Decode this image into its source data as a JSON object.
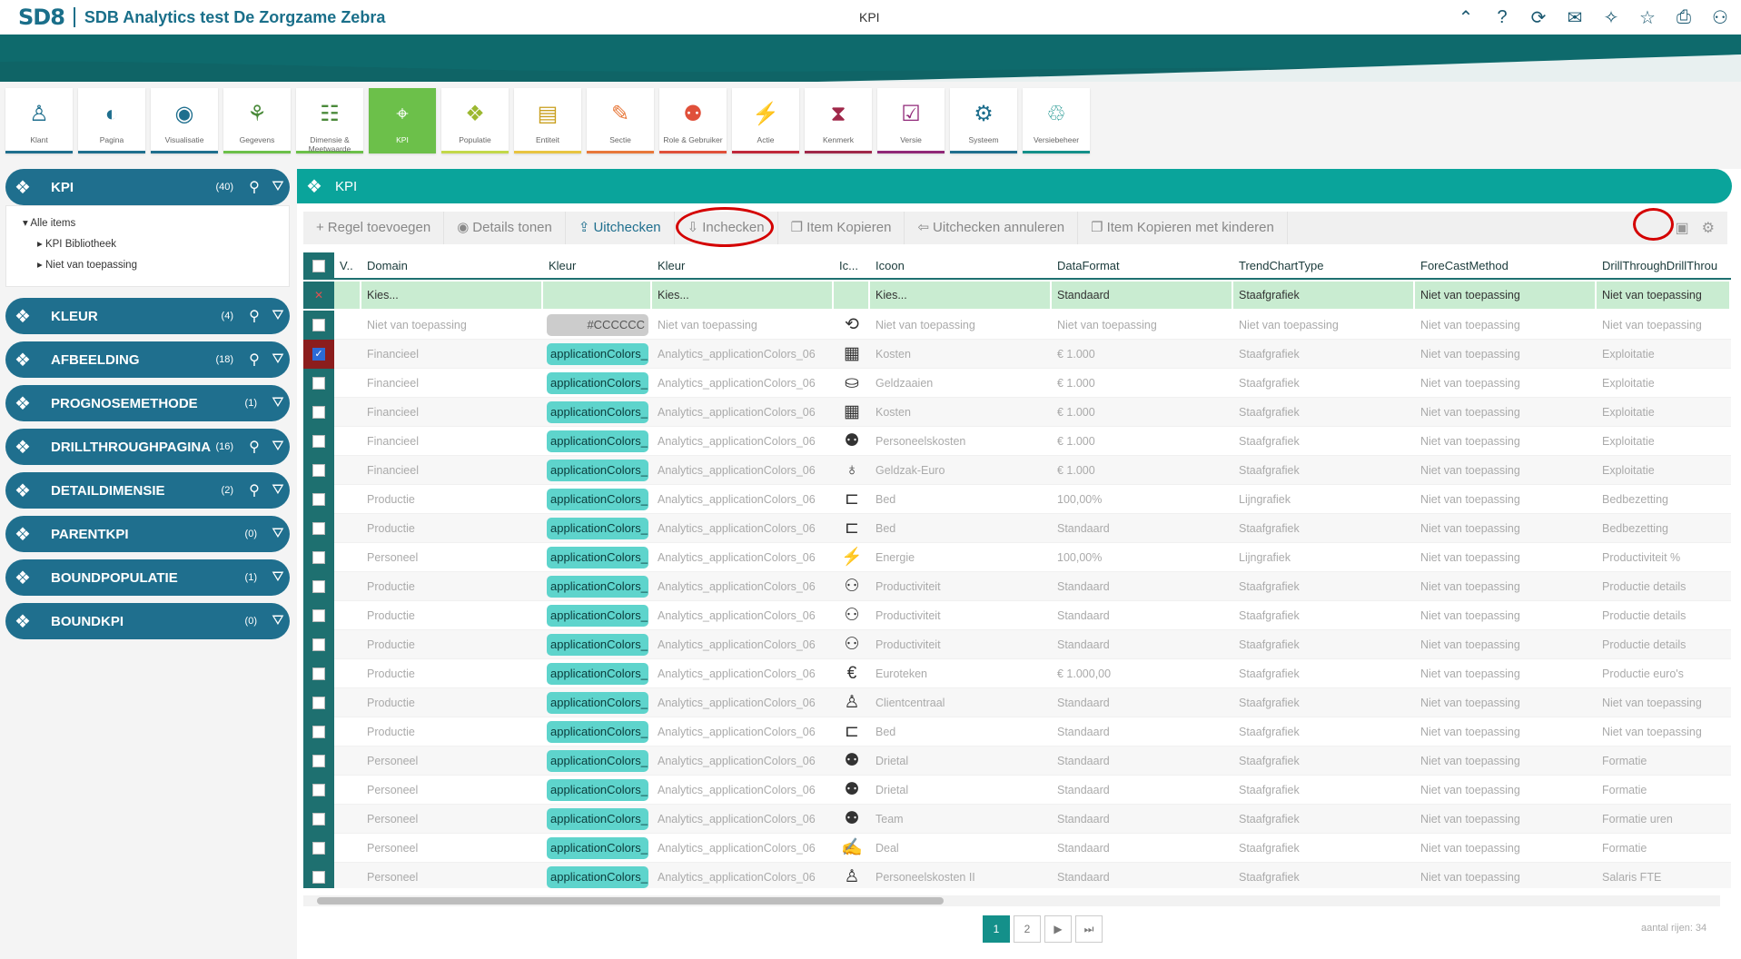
{
  "app": {
    "logo": "SD8",
    "title": "SDB Analytics test De Zorgzame Zebra",
    "page_title": "KPI"
  },
  "top_icons": [
    {
      "name": "collapse-up-icon",
      "glyph": "⌃"
    },
    {
      "name": "help-icon",
      "glyph": "?"
    },
    {
      "name": "refresh-icon",
      "glyph": "⟳"
    },
    {
      "name": "chat-icon",
      "glyph": "✉"
    },
    {
      "name": "star-plus-icon",
      "glyph": "✧"
    },
    {
      "name": "star-icon",
      "glyph": "☆"
    },
    {
      "name": "print-icon",
      "glyph": "⎙"
    },
    {
      "name": "user-icon",
      "glyph": "⚇"
    }
  ],
  "tiles": [
    {
      "label": "Klant",
      "glyph": "♙",
      "color": "#1f6f8e",
      "border": "#1f6f8e"
    },
    {
      "label": "Pagina",
      "glyph": "◐",
      "color": "#1f6f8e",
      "border": "#1f6f8e"
    },
    {
      "label": "Visualisatie",
      "glyph": "◉",
      "color": "#1f6f8e",
      "border": "#1f6f8e"
    },
    {
      "label": "Gegevens",
      "glyph": "⚘",
      "color": "#4a8a3a",
      "border": "#6cc04a"
    },
    {
      "label": "Dimensie & Meetwaarde",
      "glyph": "☷",
      "color": "#4a8a3a",
      "border": "#6cc04a"
    },
    {
      "label": "KPI",
      "glyph": "⌖",
      "color": "#ffffff",
      "border": "#6cc04a"
    },
    {
      "label": "Populatie",
      "glyph": "❖",
      "color": "#9cb830",
      "border": "#c3d84a"
    },
    {
      "label": "Entiteit",
      "glyph": "▤",
      "color": "#c9a020",
      "border": "#e8c440"
    },
    {
      "label": "Sectie",
      "glyph": "✎",
      "color": "#e8783a",
      "border": "#e8783a"
    },
    {
      "label": "Role & Gebruiker",
      "glyph": "⚉",
      "color": "#e0503a",
      "border": "#e0503a"
    },
    {
      "label": "Actie",
      "glyph": "⚡",
      "color": "#c0283a",
      "border": "#c0283a"
    },
    {
      "label": "Kenmerk",
      "glyph": "⧗",
      "color": "#a0284a",
      "border": "#a0284a"
    },
    {
      "label": "Versie",
      "glyph": "☑",
      "color": "#902878",
      "border": "#902878"
    },
    {
      "label": "Systeem",
      "glyph": "⚙",
      "color": "#1f6f8e",
      "border": "#1f6f8e"
    },
    {
      "label": "Versiebeheer",
      "glyph": "♲",
      "color": "#14908a",
      "border": "#14908a"
    }
  ],
  "left_panels": [
    {
      "name": "KPI",
      "count": "(40)",
      "search": true
    },
    {
      "name": "KLEUR",
      "count": "(4)",
      "search": true
    },
    {
      "name": "AFBEELDING",
      "count": "(18)",
      "search": true
    },
    {
      "name": "PROGNOSEMETHODE",
      "count": "(1)",
      "search": false
    },
    {
      "name": "DRILLTHROUGHPAGINA",
      "count": "(16)",
      "search": true
    },
    {
      "name": "DETAILDIMENSIE",
      "count": "(2)",
      "search": true
    },
    {
      "name": "PARENTKPI",
      "count": "(0)",
      "search": false
    },
    {
      "name": "BOUNDPOPULATIE",
      "count": "(1)",
      "search": false
    },
    {
      "name": "BOUNDKPI",
      "count": "(0)",
      "search": false
    }
  ],
  "tree": {
    "root": "Alle items",
    "children": [
      "KPI Bibliotheek",
      "Niet van toepassing"
    ]
  },
  "main": {
    "title": "KPI"
  },
  "toolbar": [
    {
      "label": "Regel toevoegen",
      "glyph": "+",
      "active": false
    },
    {
      "label": "Details tonen",
      "glyph": "◉",
      "active": false
    },
    {
      "label": "Uitchecken",
      "glyph": "⇪",
      "active": true
    },
    {
      "label": "Inchecken",
      "glyph": "⇩",
      "active": false
    },
    {
      "label": "Item Kopieren",
      "glyph": "❐",
      "active": false
    },
    {
      "label": "Uitchecken annuleren",
      "glyph": "⇦",
      "active": false
    },
    {
      "label": "Item Kopieren met kinderen",
      "glyph": "❐",
      "active": false
    }
  ],
  "columns": [
    {
      "label": "",
      "w": 34
    },
    {
      "label": "V..",
      "w": 30
    },
    {
      "label": "Domain",
      "w": 200
    },
    {
      "label": "Kleur",
      "w": 120
    },
    {
      "label": "Kleur",
      "w": 200
    },
    {
      "label": "Ic...",
      "w": 40
    },
    {
      "label": "Icoon",
      "w": 200
    },
    {
      "label": "DataFormat",
      "w": 200
    },
    {
      "label": "TrendChartType",
      "w": 200
    },
    {
      "label": "ForeCastMethod",
      "w": 200
    },
    {
      "label": "DrillThroughDrillThrou",
      "w": 148
    }
  ],
  "filters": {
    "domain": "Kies...",
    "kleur1": "",
    "kleur2": "Kies...",
    "icoon": "Kies...",
    "dataformat": "Standaard",
    "trend": "Staafgrafiek",
    "forecast": "Niet van toepassing",
    "drill": "Niet van toepassing"
  },
  "rows": [
    {
      "domain": "Niet van toepassing",
      "pill": "#CCCCCC",
      "grey": true,
      "kleur": "Niet van toepassing",
      "icon": "⟲",
      "icoon": "Niet van toepassing",
      "df": "Niet van toepassing",
      "trend": "Niet van toepassing",
      "fc": "Niet van toepassing",
      "drill": "Niet van toepassing",
      "checked": false
    },
    {
      "domain": "Financieel",
      "pill": "applicationColors_",
      "grey": false,
      "kleur": "Analytics_applicationColors_06",
      "icon": "▦",
      "icoon": "Kosten",
      "df": "€ 1.000",
      "trend": "Staafgrafiek",
      "fc": "Niet van toepassing",
      "drill": "Exploitatie",
      "checked": true
    },
    {
      "domain": "Financieel",
      "pill": "applicationColors_",
      "grey": false,
      "kleur": "Analytics_applicationColors_06",
      "icon": "⛀",
      "icoon": "Geldzaaien",
      "df": "€ 1.000",
      "trend": "Staafgrafiek",
      "fc": "Niet van toepassing",
      "drill": "Exploitatie",
      "checked": false
    },
    {
      "domain": "Financieel",
      "pill": "applicationColors_",
      "grey": false,
      "kleur": "Analytics_applicationColors_06",
      "icon": "▦",
      "icoon": "Kosten",
      "df": "€ 1.000",
      "trend": "Staafgrafiek",
      "fc": "Niet van toepassing",
      "drill": "Exploitatie",
      "checked": false
    },
    {
      "domain": "Financieel",
      "pill": "applicationColors_",
      "grey": false,
      "kleur": "Analytics_applicationColors_06",
      "icon": "⚉",
      "icoon": "Personeelskosten",
      "df": "€ 1.000",
      "trend": "Staafgrafiek",
      "fc": "Niet van toepassing",
      "drill": "Exploitatie",
      "checked": false
    },
    {
      "domain": "Financieel",
      "pill": "applicationColors_",
      "grey": false,
      "kleur": "Analytics_applicationColors_06",
      "icon": "♁",
      "icoon": "Geldzak-Euro",
      "df": "€ 1.000",
      "trend": "Staafgrafiek",
      "fc": "Niet van toepassing",
      "drill": "Exploitatie",
      "checked": false
    },
    {
      "domain": "Productie",
      "pill": "applicationColors_",
      "grey": false,
      "kleur": "Analytics_applicationColors_06",
      "icon": "⊏",
      "icoon": "Bed",
      "df": "100,00%",
      "trend": "Lijngrafiek",
      "fc": "Niet van toepassing",
      "drill": "Bedbezetting",
      "checked": false
    },
    {
      "domain": "Productie",
      "pill": "applicationColors_",
      "grey": false,
      "kleur": "Analytics_applicationColors_06",
      "icon": "⊏",
      "icoon": "Bed",
      "df": "Standaard",
      "trend": "Staafgrafiek",
      "fc": "Niet van toepassing",
      "drill": "Bedbezetting",
      "checked": false
    },
    {
      "domain": "Personeel",
      "pill": "applicationColors_",
      "grey": false,
      "kleur": "Analytics_applicationColors_06",
      "icon": "⚡",
      "icoon": "Energie",
      "df": "100,00%",
      "trend": "Lijngrafiek",
      "fc": "Niet van toepassing",
      "drill": "Productiviteit %",
      "checked": false
    },
    {
      "domain": "Productie",
      "pill": "applicationColors_",
      "grey": false,
      "kleur": "Analytics_applicationColors_06",
      "icon": "⚇",
      "icoon": "Productiviteit",
      "df": "Standaard",
      "trend": "Staafgrafiek",
      "fc": "Niet van toepassing",
      "drill": "Productie details",
      "checked": false
    },
    {
      "domain": "Productie",
      "pill": "applicationColors_",
      "grey": false,
      "kleur": "Analytics_applicationColors_06",
      "icon": "⚇",
      "icoon": "Productiviteit",
      "df": "Standaard",
      "trend": "Staafgrafiek",
      "fc": "Niet van toepassing",
      "drill": "Productie details",
      "checked": false
    },
    {
      "domain": "Productie",
      "pill": "applicationColors_",
      "grey": false,
      "kleur": "Analytics_applicationColors_06",
      "icon": "⚇",
      "icoon": "Productiviteit",
      "df": "Standaard",
      "trend": "Staafgrafiek",
      "fc": "Niet van toepassing",
      "drill": "Productie details",
      "checked": false
    },
    {
      "domain": "Productie",
      "pill": "applicationColors_",
      "grey": false,
      "kleur": "Analytics_applicationColors_06",
      "icon": "€",
      "icoon": "Euroteken",
      "df": "€ 1.000,00",
      "trend": "Staafgrafiek",
      "fc": "Niet van toepassing",
      "drill": "Productie euro's",
      "checked": false
    },
    {
      "domain": "Productie",
      "pill": "applicationColors_",
      "grey": false,
      "kleur": "Analytics_applicationColors_06",
      "icon": "♙",
      "icoon": "Clientcentraal",
      "df": "Standaard",
      "trend": "Staafgrafiek",
      "fc": "Niet van toepassing",
      "drill": "Niet van toepassing",
      "checked": false
    },
    {
      "domain": "Productie",
      "pill": "applicationColors_",
      "grey": false,
      "kleur": "Analytics_applicationColors_06",
      "icon": "⊏",
      "icoon": "Bed",
      "df": "Standaard",
      "trend": "Staafgrafiek",
      "fc": "Niet van toepassing",
      "drill": "Niet van toepassing",
      "checked": false
    },
    {
      "domain": "Personeel",
      "pill": "applicationColors_",
      "grey": false,
      "kleur": "Analytics_applicationColors_06",
      "icon": "⚉",
      "icoon": "Drietal",
      "df": "Standaard",
      "trend": "Staafgrafiek",
      "fc": "Niet van toepassing",
      "drill": "Formatie",
      "checked": false
    },
    {
      "domain": "Personeel",
      "pill": "applicationColors_",
      "grey": false,
      "kleur": "Analytics_applicationColors_06",
      "icon": "⚉",
      "icoon": "Drietal",
      "df": "Standaard",
      "trend": "Staafgrafiek",
      "fc": "Niet van toepassing",
      "drill": "Formatie",
      "checked": false
    },
    {
      "domain": "Personeel",
      "pill": "applicationColors_",
      "grey": false,
      "kleur": "Analytics_applicationColors_06",
      "icon": "⚉",
      "icoon": "Team",
      "df": "Standaard",
      "trend": "Staafgrafiek",
      "fc": "Niet van toepassing",
      "drill": "Formatie uren",
      "checked": false
    },
    {
      "domain": "Personeel",
      "pill": "applicationColors_",
      "grey": false,
      "kleur": "Analytics_applicationColors_06",
      "icon": "✍",
      "icoon": "Deal",
      "df": "Standaard",
      "trend": "Staafgrafiek",
      "fc": "Niet van toepassing",
      "drill": "Formatie",
      "checked": false
    },
    {
      "domain": "Personeel",
      "pill": "applicationColors_",
      "grey": false,
      "kleur": "Analytics_applicationColors_06",
      "icon": "♙",
      "icoon": "Personeelskosten II",
      "df": "Standaard",
      "trend": "Staafgrafiek",
      "fc": "Niet van toepassing",
      "drill": "Salaris FTE",
      "checked": false
    }
  ],
  "pager": {
    "pages": [
      "1",
      "2"
    ],
    "next": "▶",
    "last": "⏭",
    "row_count": "aantal rijen: 34"
  }
}
